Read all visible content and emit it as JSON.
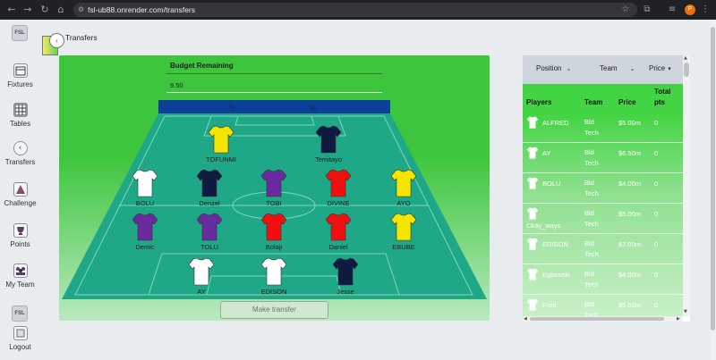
{
  "browser": {
    "url": "fsl-ub88.onrender.com/transfers",
    "profile_initial": "P"
  },
  "sidebar": {
    "logo_text": "FSL",
    "items": [
      {
        "label": "Fixtures",
        "icon": "fixtures-icon"
      },
      {
        "label": "Tables",
        "icon": "table-grid-icon"
      },
      {
        "label": "Transfers",
        "icon": "transfer-icon"
      },
      {
        "label": "Challenge",
        "icon": "challenge-icon"
      },
      {
        "label": "Points",
        "icon": "points-icon"
      },
      {
        "label": "My Team",
        "icon": "team-icon"
      },
      {
        "label": "Logout",
        "icon": "logout-icon"
      }
    ]
  },
  "header": {
    "title": "Transfers"
  },
  "budget": {
    "label": "Budget Remaining",
    "value": "9.50"
  },
  "pitch": {
    "make_transfer_label": "Make transfer",
    "colors": {
      "grass": "#1fa887",
      "lines": "#7fd6b8",
      "banner": "#0b3f9a"
    },
    "players": [
      {
        "name": "TOFUNMI",
        "shirt": "#f5e600"
      },
      {
        "name": "Temitayo",
        "shirt": "#0f1a40"
      },
      {
        "name": "BOLU",
        "shirt": "#ffffff"
      },
      {
        "name": "Denzel",
        "shirt": "#0f1a40"
      },
      {
        "name": "TOBI",
        "shirt": "#6a2aa0"
      },
      {
        "name": "DIVINE",
        "shirt": "#f01010"
      },
      {
        "name": "AYO",
        "shirt": "#f5e600"
      },
      {
        "name": "Demic",
        "shirt": "#6a2aa0"
      },
      {
        "name": "TOLU",
        "shirt": "#6a2aa0"
      },
      {
        "name": "Bolaji",
        "shirt": "#f01010"
      },
      {
        "name": "Daniel",
        "shirt": "#f01010"
      },
      {
        "name": "EBUBE",
        "shirt": "#f5e600"
      },
      {
        "name": "AY",
        "shirt": "#ffffff"
      },
      {
        "name": "EDISON",
        "shirt": "#ffffff"
      },
      {
        "name": "Jesse",
        "shirt": "#0f1a40"
      }
    ]
  },
  "market": {
    "filters": {
      "position": "Position",
      "team": "Team",
      "price": "Price"
    },
    "columns": {
      "players": "Players",
      "team": "Team",
      "price": "Price",
      "total_pts_line1": "Total",
      "total_pts_line2": "pts"
    },
    "rows": [
      {
        "player": "ALFRED",
        "team_line1": "Bld",
        "team_line2": "Tech",
        "price": "$5.00m",
        "pts": "0"
      },
      {
        "player": "AY",
        "team_line1": "Bld",
        "team_line2": "Tech",
        "price": "$6.50m",
        "pts": "0"
      },
      {
        "player": "BOLU",
        "team_line1": "Bld",
        "team_line2": "Tech",
        "price": "$4.00m",
        "pts": "0"
      },
      {
        "player": "Ckay_ways",
        "team_line1": "Bld",
        "team_line2": "Tech",
        "price": "$5.00m",
        "pts": "0"
      },
      {
        "player": "EDISON",
        "team_line1": "Bld",
        "team_line2": "Tech",
        "price": "$7.00m",
        "pts": "0"
      },
      {
        "player": "Egbeseki",
        "team_line1": "Bld",
        "team_line2": "Tech",
        "price": "$4.00m",
        "pts": "0"
      },
      {
        "player": "Fred",
        "team_line1": "Bld",
        "team_line2": "Tech",
        "price": "$5.50m",
        "pts": "0"
      }
    ]
  }
}
